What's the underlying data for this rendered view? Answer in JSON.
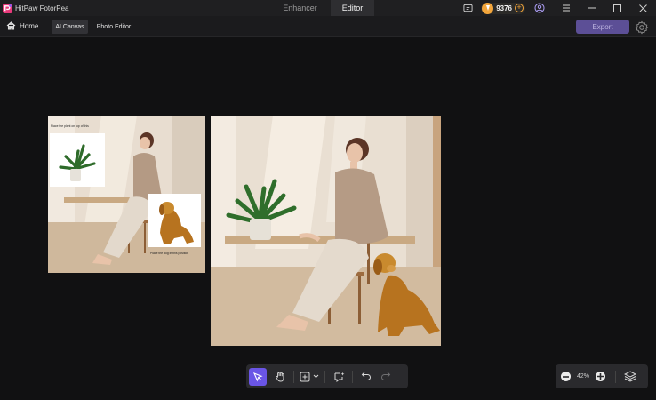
{
  "app": {
    "name": "HitPaw FotorPea",
    "logo_icon": "hitpaw-logo-icon"
  },
  "top_tabs": [
    {
      "label": "Enhancer",
      "active": false
    },
    {
      "label": "Editor",
      "active": true
    }
  ],
  "title_bar": {
    "credits": "9376",
    "icons": [
      "feedback-icon",
      "coin-icon",
      "add-credits-icon",
      "account-icon",
      "menu-icon",
      "minimize-icon",
      "maximize-icon",
      "close-icon"
    ]
  },
  "nav": {
    "home_label": "Home",
    "tabs": [
      {
        "label": "AI Canvas",
        "active": true
      },
      {
        "label": "Photo Editor",
        "active": false
      }
    ],
    "export_label": "Export"
  },
  "canvases": {
    "source": {
      "note_top": "Place the plant on top of this",
      "note_bottom": "Place the dog in this position"
    }
  },
  "toolbar": {
    "tools": [
      "select-icon",
      "hand-icon",
      "add-frame-icon",
      "chevron-down-icon",
      "ai-edit-icon",
      "undo-icon",
      "redo-icon"
    ],
    "active_tool": "select-icon"
  },
  "zoom": {
    "value": "42%"
  },
  "colors": {
    "accent": "#6a55e6",
    "export_bg": "#5c4f96",
    "coin": "#f2a53b",
    "background": "#111112"
  }
}
